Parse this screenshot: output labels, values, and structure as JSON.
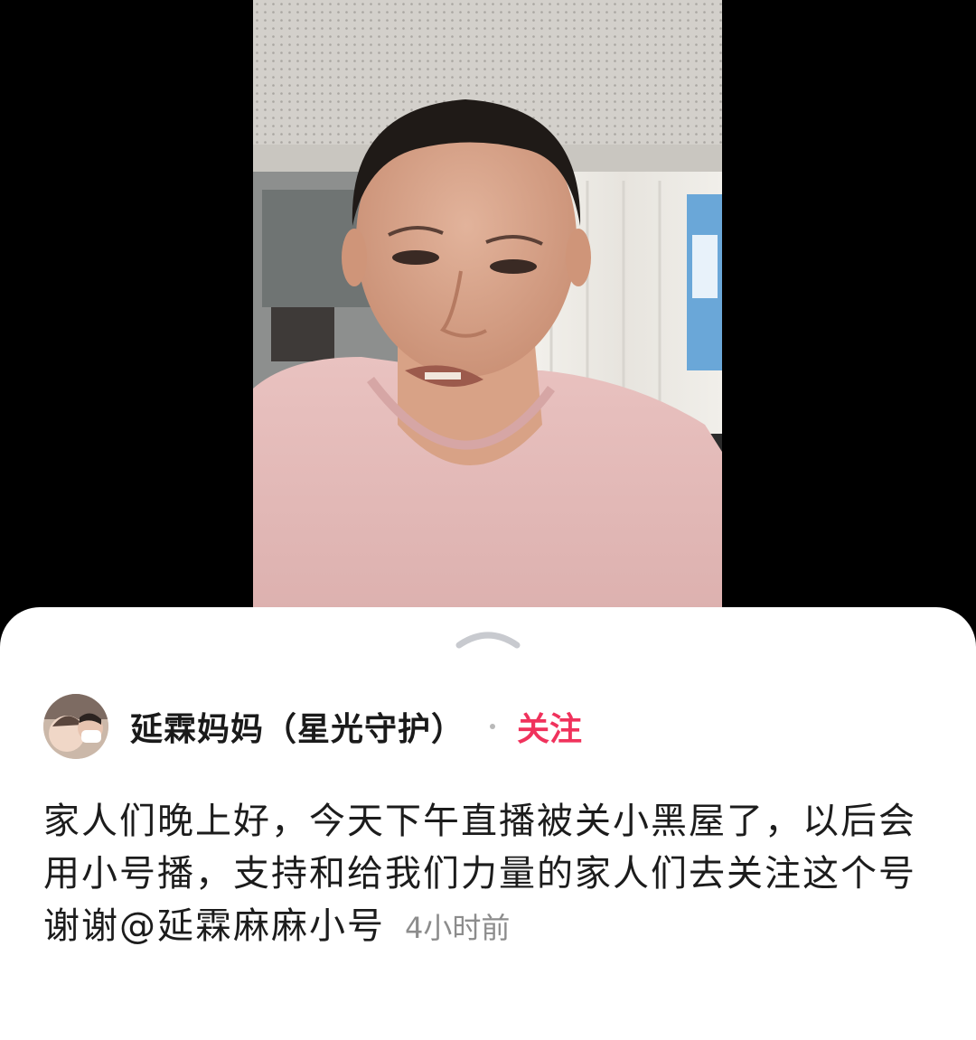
{
  "post": {
    "author_name": "延霖妈妈（星光守护）",
    "follow_label": "关注",
    "text": "家人们晚上好，今天下午直播被关小黑屋了，以后会用小号播，支持和给我们力量的家人们去关注这个号谢谢@延霖麻麻小号",
    "time": "4小时前"
  },
  "icons": {
    "handle": "chevron-up-icon",
    "avatar": "user-avatar"
  },
  "colors": {
    "follow": "#f0325c",
    "sheet": "#ffffff",
    "background": "#000000"
  }
}
